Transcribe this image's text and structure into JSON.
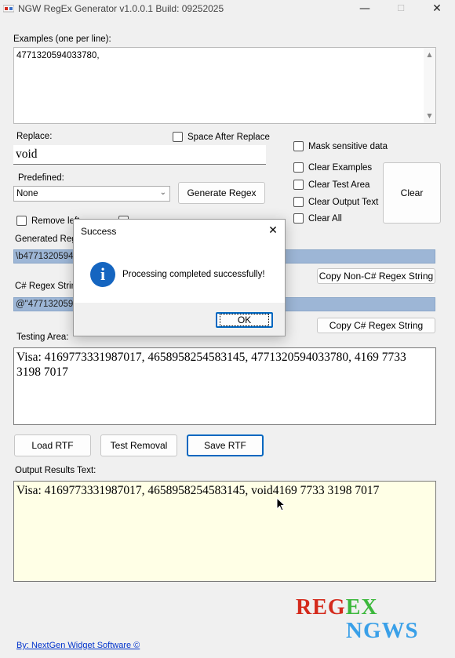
{
  "window": {
    "title": "NGW RegEx Generator v1.0.0.1 Build: 09252025",
    "minimize": "—",
    "maximize": "☐",
    "close": "✕"
  },
  "examples": {
    "label": "Examples (one per line):",
    "value": "4771320594033780,"
  },
  "replace": {
    "label": "Replace:",
    "value": "void",
    "space_after_label": "Space After Replace"
  },
  "predefined": {
    "label": "Predefined:",
    "selected": "None"
  },
  "generate_button": "Generate Regex",
  "options": {
    "mask_sensitive": "Mask sensitive data",
    "clear_examples": "Clear Examples",
    "clear_test_area": "Clear Test Area",
    "clear_output_text": "Clear Output Text",
    "clear_all": "Clear All",
    "clear_button": "Clear"
  },
  "remove_left_partial": "Remove left",
  "generated_regex": {
    "label_partial": "Generated Rege",
    "value_partial": "\\b47713205940"
  },
  "copy_non_csharp_button": "Copy Non-C# Regex String",
  "csharp_regex": {
    "label_partial": "C# Regex String",
    "value_partial": "@\"477132059"
  },
  "copy_csharp_button": "Copy C# Regex String",
  "testing_area": {
    "label": "Testing Area:",
    "text": "Visa: 4169773331987017, 4658958254583145, 4771320594033780, 4169 7733 3198 7017"
  },
  "buttons": {
    "load_rtf": "Load RTF",
    "test_removal": "Test Removal",
    "save_rtf": "Save RTF"
  },
  "output": {
    "label": "Output Results Text:",
    "text": "Visa: 4169773331987017, 4658958254583145, void4169 7733 3198 7017"
  },
  "dialog": {
    "title": "Success",
    "message": "Processing completed successfully!",
    "ok": "OK",
    "close": "✕",
    "icon_glyph": "i"
  },
  "logo": {
    "line1_a": "REG",
    "line1_b": "EX",
    "line2": "NGWS"
  },
  "footer_link": "By: NextGen Widget Software  ©",
  "colors": {
    "background": "#f0f0f0",
    "output_bg": "#ffffe6",
    "highlight": "#9db6d6",
    "logo_red": "#d42a1c",
    "logo_green": "#3cb83c",
    "logo_blue": "#3aa0e8",
    "info_blue": "#1565c0",
    "link": "#0033cc"
  }
}
